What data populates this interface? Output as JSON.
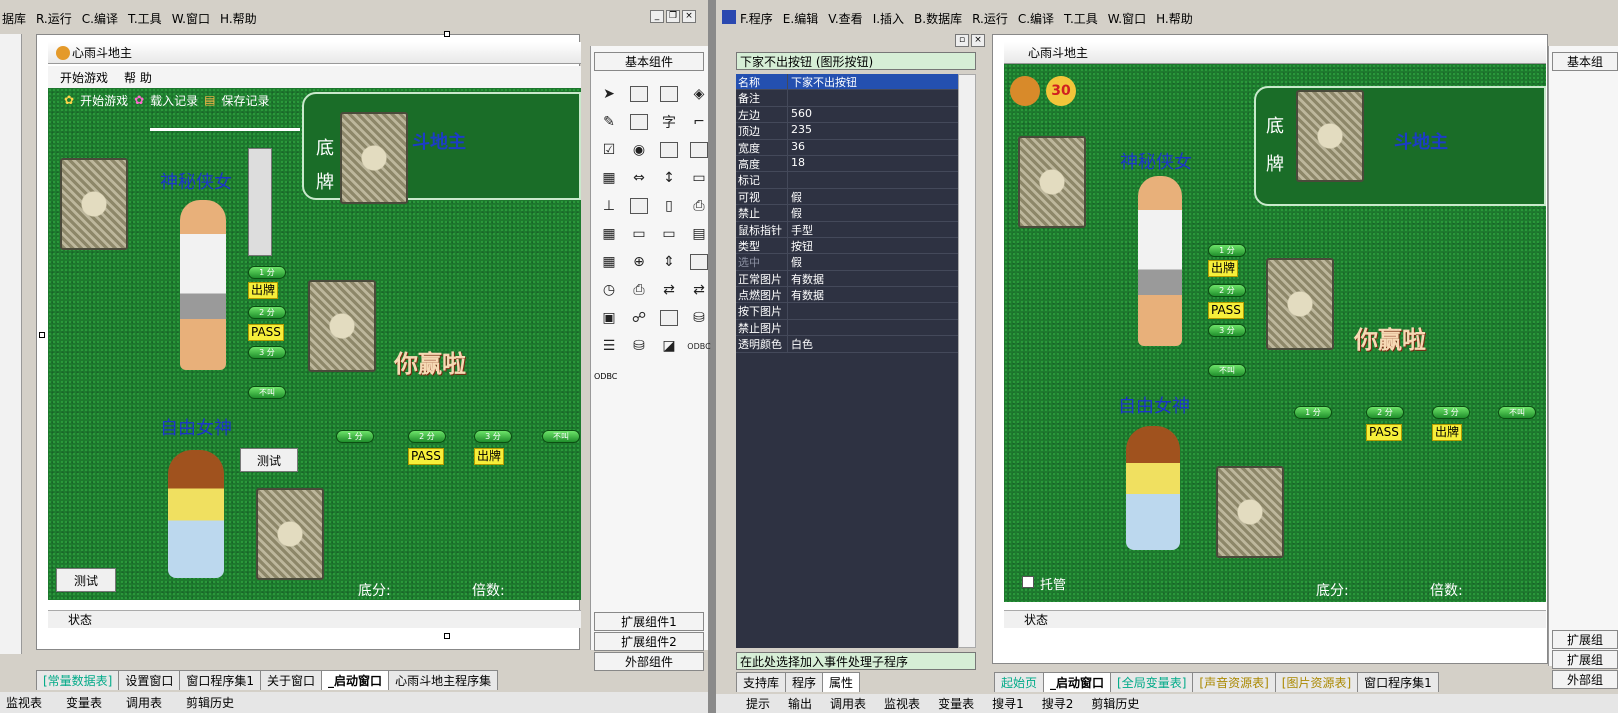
{
  "left_menu": [
    "据库",
    "R.运行",
    "C.编译",
    "T.工具",
    "W.窗口",
    "H.帮助"
  ],
  "right_menu": [
    "F.程序",
    "E.编辑",
    "V.查看",
    "I.插入",
    "B.数据库",
    "R.运行",
    "C.编译",
    "T.工具",
    "W.窗口",
    "H.帮助"
  ],
  "form": {
    "title": "心雨斗地主",
    "menu": [
      "开始游戏",
      "帮 助"
    ],
    "toolbar": [
      "开始游戏",
      "载入记录",
      "保存记录"
    ],
    "bottom_cards_label": "底牌",
    "game_title": "斗地主",
    "player_top": "神秘侠女",
    "player_bottom": "自由女神",
    "btn_pass": "PASS",
    "btn_play": "出牌",
    "pill_1": "1 分",
    "pill_2": "2 分",
    "pill_3": "3 分",
    "pill_no": "不叫",
    "test_button": "测试",
    "score_label": "底分:",
    "multiplier_label": "倍数:",
    "win_text": "你赢啦",
    "status": "状态"
  },
  "components": {
    "basic": "基本组件",
    "ext1": "扩展组件1",
    "ext2": "扩展组件2",
    "external": "外部组件",
    "odbc": "ODBC"
  },
  "left_tabs": [
    "[常量数据表]",
    "设置窗口",
    "窗口程序集1",
    "关于窗口",
    "_启动窗口",
    "心雨斗地主程序集"
  ],
  "props": {
    "selector": "下家不出按钮 (图形按钮)",
    "rows": [
      [
        "名称",
        "下家不出按钮"
      ],
      [
        "备注",
        ""
      ],
      [
        "左边",
        "560"
      ],
      [
        "顶边",
        "235"
      ],
      [
        "宽度",
        "36"
      ],
      [
        "高度",
        "18"
      ],
      [
        "标记",
        ""
      ],
      [
        "可视",
        "假"
      ],
      [
        "禁止",
        "假"
      ],
      [
        "鼠标指针",
        "手型"
      ],
      [
        "类型",
        "按钮"
      ],
      [
        "选中",
        "假"
      ],
      [
        "正常图片",
        "有数据"
      ],
      [
        "点燃图片",
        "有数据"
      ],
      [
        "按下图片",
        ""
      ],
      [
        "禁止图片",
        ""
      ],
      [
        "透明颜色",
        "白色"
      ]
    ],
    "event": "在此处选择加入事件处理子程序",
    "tabs": [
      "支持库",
      "程序",
      "属性"
    ]
  },
  "runtime": {
    "title": "心雨斗地主",
    "timer": "30",
    "trustee": "托管",
    "score_label": "底分:",
    "multiplier_label": "倍数:"
  },
  "right_tabs": [
    "起始页",
    "_启动窗口",
    "[全局变量表]",
    "[声音资源表]",
    "[图片资源表]",
    "窗口程序集1"
  ],
  "right_components": {
    "basic": "基本组",
    "ext1": "扩展组",
    "ext2": "扩展组",
    "external": "外部组"
  },
  "bottom_left": [
    "监视表",
    "变量表",
    "调用表",
    "剪辑历史"
  ],
  "bottom_right": [
    "提示",
    "输出",
    "调用表",
    "监视表",
    "变量表",
    "搜寻1",
    "搜寻2",
    "剪辑历史"
  ]
}
